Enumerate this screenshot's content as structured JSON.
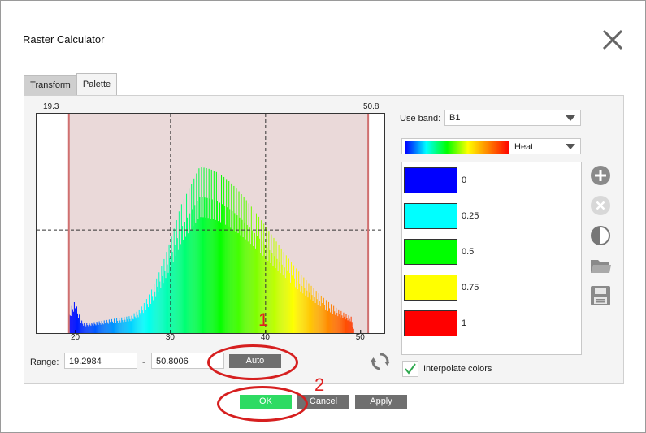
{
  "window": {
    "title": "Raster Calculator"
  },
  "tabs": [
    {
      "label": "Transform",
      "active": false
    },
    {
      "label": "Palette",
      "active": true
    }
  ],
  "histogram": {
    "min_label": "19.3",
    "max_label": "50.8",
    "x_ticks": [
      "20",
      "30",
      "40",
      "50"
    ],
    "x_tick_values": [
      20,
      30,
      40,
      50
    ],
    "x_range": [
      15.9,
      52.5
    ],
    "limits": [
      19.3,
      50.8
    ],
    "colormap": "Heat"
  },
  "range": {
    "label": "Range:",
    "min_value": "19.2984",
    "separator": "-",
    "max_value": "50.8006",
    "auto_label": "Auto"
  },
  "band": {
    "label": "Use band:",
    "value": "B1"
  },
  "palette": {
    "name": "Heat"
  },
  "stops": [
    {
      "value": "0",
      "color": "#0000ff"
    },
    {
      "value": "0.25",
      "color": "#00ffff"
    },
    {
      "value": "0.5",
      "color": "#00ff00"
    },
    {
      "value": "0.75",
      "color": "#ffff00"
    },
    {
      "value": "1",
      "color": "#ff0000"
    }
  ],
  "interpolate": {
    "label": "Interpolate colors",
    "checked": true
  },
  "side_icons": [
    "add-icon",
    "remove-icon",
    "contrast-icon",
    "folder-icon",
    "save-icon"
  ],
  "buttons": {
    "ok": "OK",
    "cancel": "Cancel",
    "apply": "Apply"
  },
  "annotations": {
    "one": "1",
    "two": "2"
  },
  "colors": {
    "accent_ok": "#2edb63",
    "button_gray": "#6f6f6f",
    "annotation_red": "#d61f1f",
    "hist_bg": "#ead9d9"
  }
}
